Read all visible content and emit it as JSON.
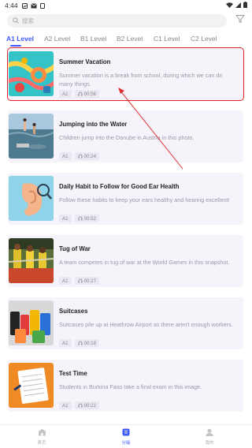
{
  "status_bar": {
    "time": "4:44"
  },
  "search": {
    "placeholder": "搜索"
  },
  "tabs": [
    {
      "label": "A1 Level",
      "active": true
    },
    {
      "label": "A2 Level",
      "active": false
    },
    {
      "label": "B1 Level",
      "active": false
    },
    {
      "label": "B2 Level",
      "active": false
    },
    {
      "label": "C1 Level",
      "active": false
    },
    {
      "label": "C2 Level",
      "active": false
    }
  ],
  "articles": [
    {
      "title": "Summer Vacation",
      "description": "Summer vacation is a break from school, during which we can do many things.",
      "level": "A1",
      "duration": "00:56",
      "highlighted": true
    },
    {
      "title": "Jumping into the Water",
      "description": "Children jump into the Danube in Austria in this photo.",
      "level": "A1",
      "duration": "00:24"
    },
    {
      "title": "Daily Habit to Follow for Good Ear Health",
      "description": "Follow these habits to keep your ears healthy and hearing excellent!",
      "level": "A1",
      "duration": "00:52"
    },
    {
      "title": "Tug of War",
      "description": "A team competes in tug of war at the World Games in this snapshot.",
      "level": "A1",
      "duration": "00:27"
    },
    {
      "title": "Suitcases",
      "description": "Suitcases pile up at Heathrow Airport as there aren't enough workers.",
      "level": "A1",
      "duration": "00:18"
    },
    {
      "title": "Test Time",
      "description": "Students in Burkina Faso take a final exam in this image.",
      "level": "A1",
      "duration": "00:22"
    }
  ],
  "bottom_nav": [
    {
      "label": "首页",
      "icon": "home-icon",
      "active": false
    },
    {
      "label": "分级",
      "icon": "level-icon",
      "active": true
    },
    {
      "label": "我的",
      "icon": "profile-icon",
      "active": false
    }
  ],
  "colors": {
    "accent": "#3d5afe",
    "card_bg": "#f6f3fb",
    "highlight": "#e2232a"
  }
}
